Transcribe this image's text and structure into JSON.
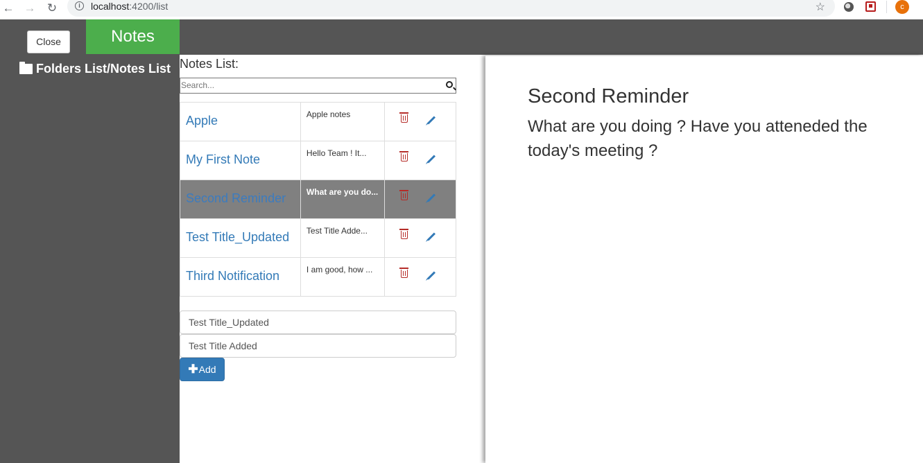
{
  "browser": {
    "url_host": "localhost",
    "url_path": ":4200/list",
    "avatar_letter": "c"
  },
  "header": {
    "close_label": "Close",
    "brand": "Notes",
    "brand_color": "#4cae4c",
    "bar_color": "#555555"
  },
  "sidebar": {
    "link_label": "Folders List/Notes List",
    "link_icon": "folder-icon"
  },
  "notes_list": {
    "heading": "Notes List:",
    "search_placeholder": "Search...",
    "search_value": "",
    "rows": [
      {
        "title": "Apple",
        "snippet": "Apple notes",
        "selected": false
      },
      {
        "title": "My First Note",
        "snippet": "Hello Team ! It...",
        "selected": false
      },
      {
        "title": "Second Reminder",
        "snippet": "What are you do...",
        "selected": true
      },
      {
        "title": "Test Title_Updated",
        "snippet": "Test Title Adde...",
        "selected": false
      },
      {
        "title": "Third Notification",
        "snippet": "I am good, how ...",
        "selected": false
      }
    ]
  },
  "form": {
    "title_value": "Test Title_Updated",
    "body_value": "Test Title Added",
    "add_label": "Add"
  },
  "viewer": {
    "title": "Second Reminder",
    "body": "What are you doing ? Have you atteneded the today's meeting ?"
  }
}
